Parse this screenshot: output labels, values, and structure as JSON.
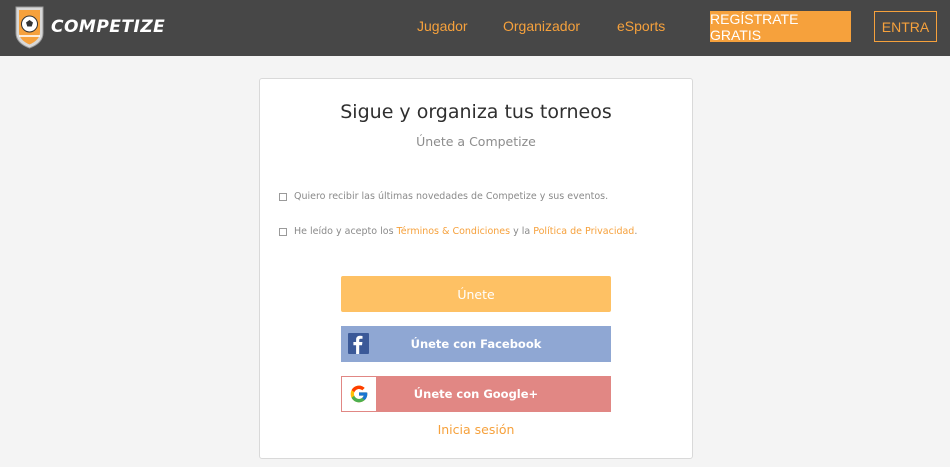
{
  "header": {
    "brand": "COMPETIZE",
    "nav": {
      "player": "Jugador",
      "organizer": "Organizador",
      "esports": "eSports"
    },
    "register_label": "REGÍSTRATE GRATIS",
    "login_label": "ENTRA"
  },
  "card": {
    "title": "Sigue y organiza tus torneos",
    "subtitle": "Únete a Competize",
    "newsletter_label": "Quiero recibir las últimas novedades de Competize y sus eventos.",
    "terms": {
      "prefix": "He leído y acepto los ",
      "terms_link": "Términos & Condiciones",
      "middle": " y la ",
      "privacy_link": "Política de Privacidad",
      "suffix": "."
    },
    "join_label": "Únete",
    "facebook_label": "Únete con Facebook",
    "google_label": "Únete con Google+",
    "signin_label": "Inicia sesión"
  },
  "colors": {
    "accent": "#f6a13c",
    "topbar": "#474747",
    "join_button": "#fec164",
    "facebook_button": "#8fa7d3",
    "google_button": "#e18784"
  },
  "icons": {
    "logo": "soccer-ball-shield-icon",
    "facebook": "facebook-icon",
    "google": "google-icon"
  }
}
